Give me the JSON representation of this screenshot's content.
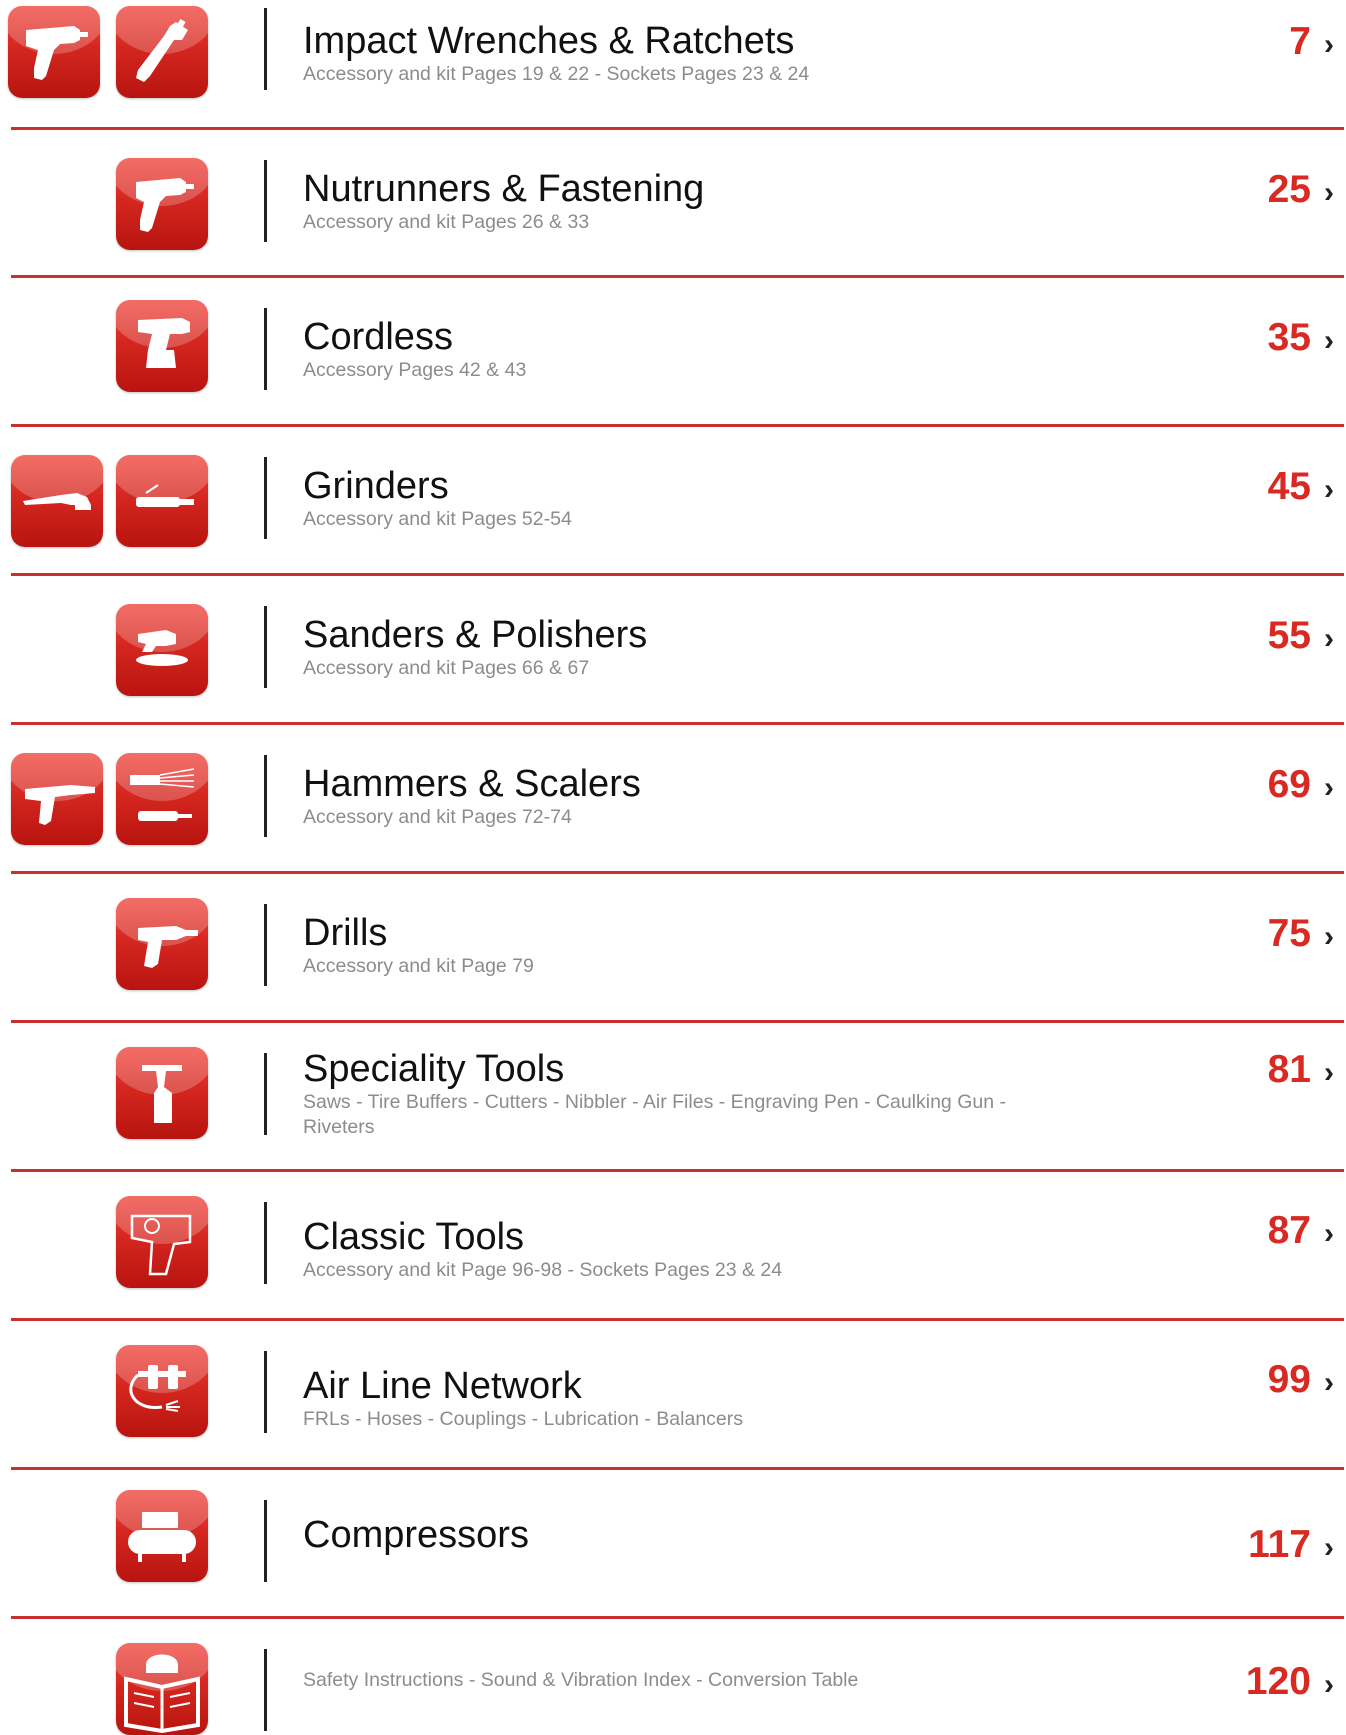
{
  "toc": {
    "chevron": "›",
    "entries": [
      {
        "title": "Impact Wrenches & Ratchets",
        "subtitle": "Accessory and kit Pages 19 & 22 - Sockets Pages 23 & 24",
        "page": "7",
        "icons": [
          "impact-wrench-icon",
          "ratchet-icon"
        ]
      },
      {
        "title": "Nutrunners & Fastening",
        "subtitle": "Accessory and kit Pages 26 & 33",
        "page": "25",
        "icons": [
          "nutrunner-icon"
        ]
      },
      {
        "title": "Cordless",
        "subtitle": "Accessory Pages 42 & 43",
        "page": "35",
        "icons": [
          "cordless-tool-icon"
        ]
      },
      {
        "title": "Grinders",
        "subtitle": "Accessory and kit Pages 52-54",
        "page": "45",
        "icons": [
          "angle-grinder-icon",
          "die-grinder-icon"
        ]
      },
      {
        "title": "Sanders & Polishers",
        "subtitle": "Accessory and kit Pages 66 & 67",
        "page": "55",
        "icons": [
          "orbital-sander-icon"
        ]
      },
      {
        "title": "Hammers & Scalers",
        "subtitle": "Accessory and kit Pages 72-74",
        "page": "69",
        "icons": [
          "air-hammer-icon",
          "needle-scaler-icon"
        ]
      },
      {
        "title": "Drills",
        "subtitle": "Accessory and kit Page 79",
        "page": "75",
        "icons": [
          "drill-icon"
        ]
      },
      {
        "title": "Speciality Tools",
        "subtitle": "Saws - Tire Buffers - Cutters - Nibbler - Air Files - Engraving Pen - Caulking Gun - Riveters",
        "page": "81",
        "icons": [
          "riveter-icon"
        ]
      },
      {
        "title": "Classic Tools",
        "subtitle": "Accessory and kit Page 96-98 - Sockets Pages 23 & 24",
        "page": "87",
        "icons": [
          "classic-impact-wrench-icon"
        ]
      },
      {
        "title": "Air Line Network",
        "subtitle": "FRLs - Hoses - Couplings - Lubrication - Balancers",
        "page": "99",
        "icons": [
          "air-line-frl-icon"
        ]
      },
      {
        "title": "Compressors",
        "subtitle": "",
        "page": "117",
        "icons": [
          "compressor-icon"
        ]
      },
      {
        "title": "",
        "subtitle": "Safety Instructions - Sound & Vibration Index - Conversion Table",
        "page": "120",
        "icons": [
          "safety-manual-icon"
        ]
      }
    ]
  }
}
